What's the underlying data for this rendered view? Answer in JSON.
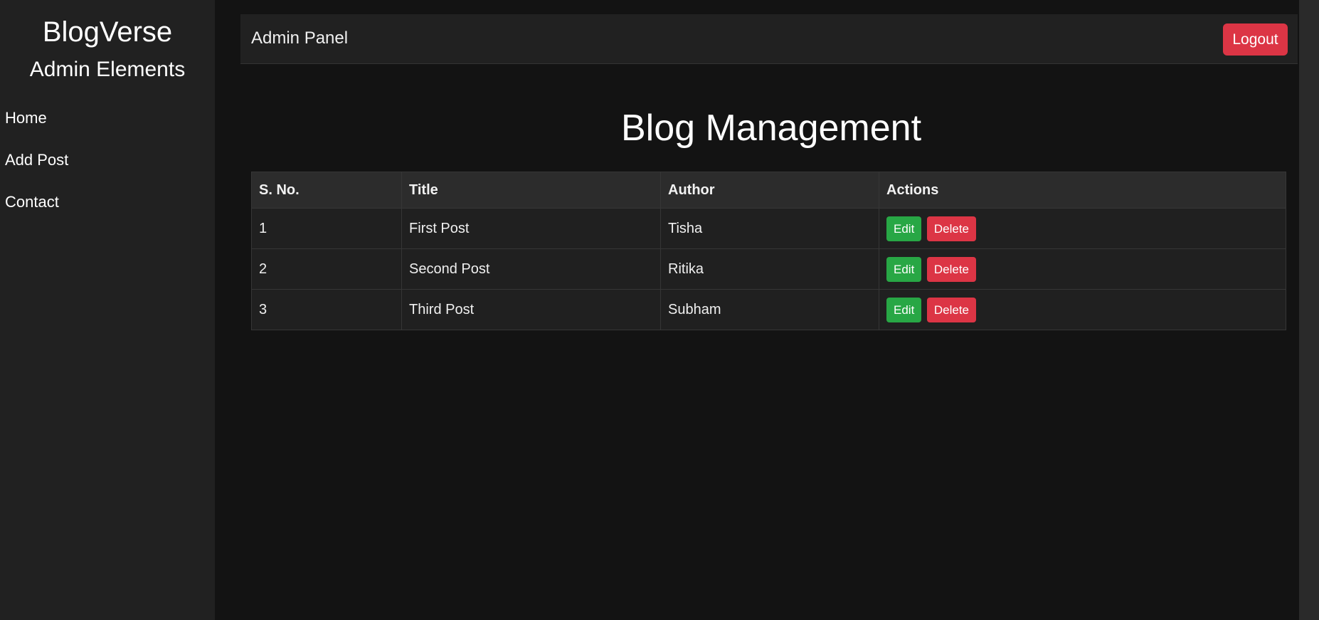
{
  "sidebar": {
    "brand": "BlogVerse",
    "subtitle": "Admin Elements",
    "items": [
      {
        "label": "Home"
      },
      {
        "label": "Add Post"
      },
      {
        "label": "Contact"
      }
    ]
  },
  "topbar": {
    "title": "Admin Panel",
    "logout_label": "Logout"
  },
  "main": {
    "heading": "Blog Management"
  },
  "table": {
    "headers": [
      "S. No.",
      "Title",
      "Author",
      "Actions"
    ],
    "rows": [
      {
        "sno": "1",
        "title": "First Post",
        "author": "Tisha"
      },
      {
        "sno": "2",
        "title": "Second Post",
        "author": "Ritika"
      },
      {
        "sno": "3",
        "title": "Third Post",
        "author": "Subham"
      }
    ],
    "edit_label": "Edit",
    "delete_label": "Delete"
  },
  "colors": {
    "background": "#131313",
    "sidebar": "#212121",
    "danger": "#dc3545",
    "success": "#28a745"
  }
}
